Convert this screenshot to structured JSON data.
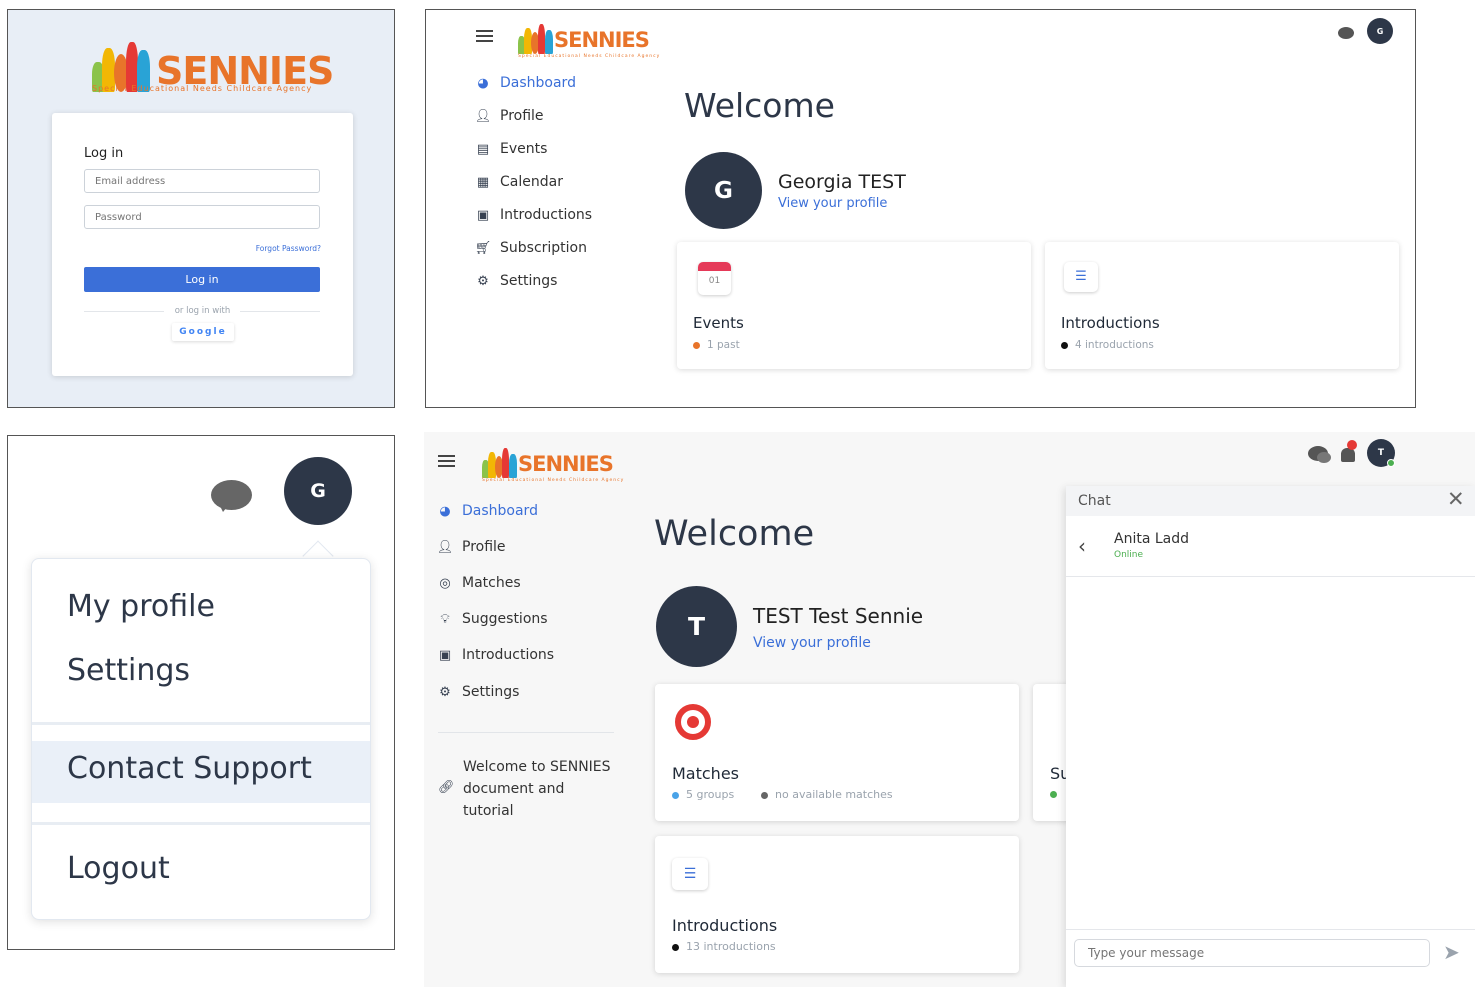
{
  "brand": {
    "name": "SENNIES",
    "tagline": "Special Educational Needs Childcare Agency"
  },
  "login": {
    "title": "Log in",
    "email_placeholder": "Email address",
    "password_placeholder": "Password",
    "forgot": "Forgot Password?",
    "submit": "Log in",
    "alt": "or log in with",
    "google": "Google"
  },
  "dash1": {
    "avatar": "G",
    "nav": [
      "Dashboard",
      "Profile",
      "Events",
      "Calendar",
      "Introductions",
      "Subscription",
      "Settings"
    ],
    "welcome": "Welcome",
    "user_initial": "G",
    "user_name": "Georgia TEST",
    "profile_link": "View your profile",
    "cards": [
      {
        "icon_text": "01",
        "title": "Events",
        "stat": "1 past",
        "dot_color": "#e8742a"
      },
      {
        "title": "Introductions",
        "stat": "4 introductions",
        "dot_color": "#111111"
      }
    ]
  },
  "menu": {
    "avatar": "G",
    "items": [
      "My profile",
      "Settings",
      "Contact Support",
      "Logout"
    ]
  },
  "dash2": {
    "avatar": "T",
    "nav": [
      "Dashboard",
      "Profile",
      "Matches",
      "Suggestions",
      "Introductions",
      "Settings"
    ],
    "doc_link": "Welcome to SENNIES document and tutorial",
    "welcome": "Welcome",
    "user_initial": "T",
    "user_name": "TEST Test Sennie",
    "profile_link": "View your profile",
    "matches": {
      "title": "Matches",
      "stat1": "5 groups",
      "stat2": "no available matches"
    },
    "partial_card": "Su",
    "introductions": {
      "title": "Introductions",
      "stat": "13 introductions"
    },
    "chat": {
      "title": "Chat",
      "contact": "Anita Ladd",
      "status": "Online",
      "placeholder": "Type your message"
    }
  },
  "colors": {
    "accent": "#3b6fd8",
    "navy": "#2d3748",
    "brand_orange": "#e8742a",
    "online": "#4caf50"
  }
}
